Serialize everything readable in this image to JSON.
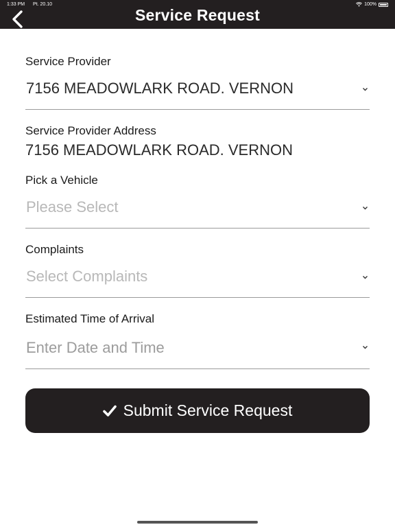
{
  "status_bar": {
    "time": "1:33 PM",
    "date": "Pt. 20.10",
    "battery": "100%"
  },
  "header": {
    "title": "Service Request"
  },
  "form": {
    "service_provider": {
      "label": "Service Provider",
      "value": "7156 MEADOWLARK ROAD. VERNON"
    },
    "provider_address": {
      "label": "Service Provider Address",
      "value": "7156 MEADOWLARK ROAD. VERNON"
    },
    "vehicle": {
      "label": "Pick a Vehicle",
      "placeholder": "Please Select"
    },
    "complaints": {
      "label": "Complaints",
      "placeholder": "Select Complaints"
    },
    "eta": {
      "label": "Estimated Time of Arrival",
      "placeholder": "Enter Date and Time"
    }
  },
  "submit": {
    "label": "Submit Service Request"
  },
  "colors": {
    "header_bg": "#231f20",
    "button_bg": "#231f20",
    "placeholder": "#b8b8b8",
    "divider": "#9a9a9a"
  },
  "icons": {
    "back": "chevron-left-icon",
    "dropdown": "chevron-down-icon",
    "submit": "checkmark-icon"
  }
}
